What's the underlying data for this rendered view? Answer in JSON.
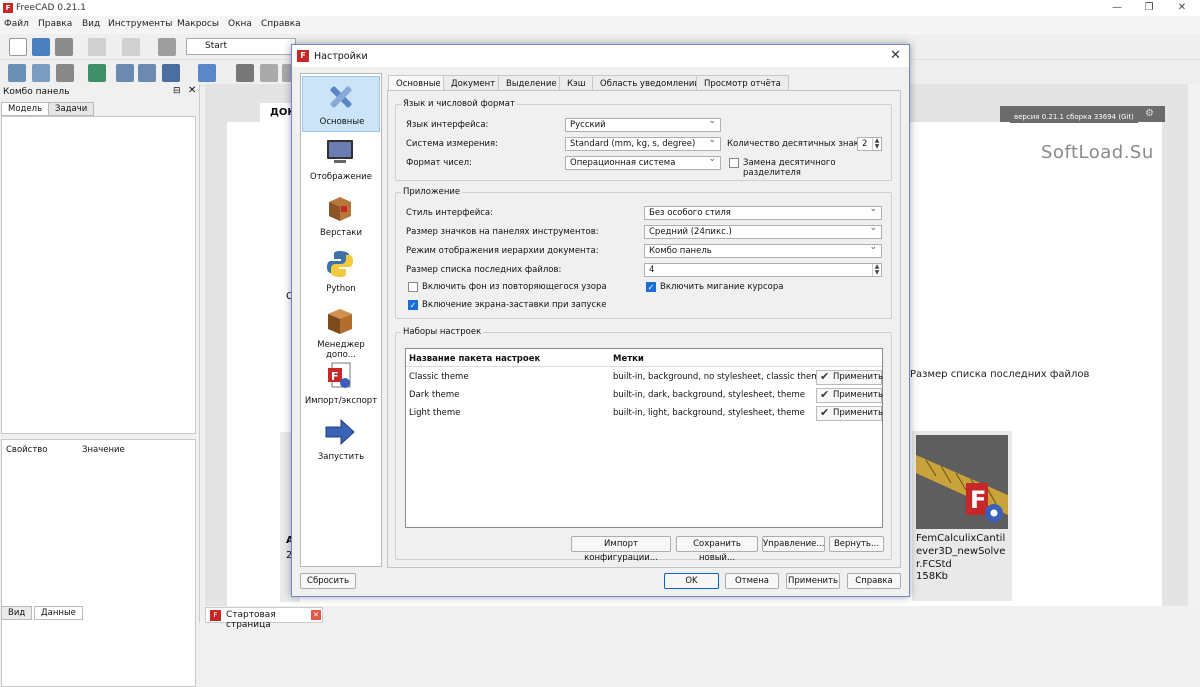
{
  "app": {
    "title": "FreeCAD 0.21.1",
    "menu": [
      "Файл",
      "Правка",
      "Вид",
      "Инструменты",
      "Макросы",
      "Окна",
      "Справка"
    ],
    "workbench": "Start"
  },
  "combo": {
    "title": "Комбо панель",
    "tabs": [
      "Модель",
      "Задачи"
    ],
    "prop_headers": [
      "Свойство",
      "Значение"
    ],
    "bottom_tabs": [
      "Вид",
      "Данные"
    ]
  },
  "startpage": {
    "tab_label": "ДОК",
    "version": "версия 0.21.1 сборка 33694 (Git)",
    "watermark": "SoftLoad.Su",
    "right_label": "Размер списка последних файлов",
    "card": {
      "name": "FemCalculixCantilever3D_newSolver.FCStd",
      "size": "158Kb"
    },
    "left_card_letter": "A",
    "left_card_digit": "2",
    "left_c": "C",
    "bottom_tab": "Стартовая страница"
  },
  "dialog": {
    "title": "Настройки",
    "categories": [
      "Основные",
      "Отображение",
      "Верстаки",
      "Python",
      "Менеджер допо...",
      "Импорт/экспорт",
      "Запустить"
    ],
    "tabs": [
      "Основные",
      "Документ",
      "Выделение",
      "Кэш",
      "Область уведомлений",
      "Просмотр отчёта"
    ],
    "lang_group": {
      "title": "Язык и числовой формат",
      "lang_label": "Язык интерфейса:",
      "lang_value": "Русский",
      "units_label": "Система измерения:",
      "units_value": "Standard (mm, kg, s, degree)",
      "decimals_label": "Количество десятичных знаков:",
      "decimals_value": "2",
      "numfmt_label": "Формат чисел:",
      "numfmt_value": "Операционная система",
      "separator_label": "Замена десятичного разделителя",
      "separator_checked": false
    },
    "app_group": {
      "title": "Приложение",
      "style_label": "Стиль интерфейса:",
      "style_value": "Без особого стиля",
      "iconsize_label": "Размер значков на панелях инструментов:",
      "iconsize_value": "Средний (24пикс.)",
      "tree_label": "Режим отображения иерархии документа:",
      "tree_value": "Комбо панель",
      "recent_label": "Размер списка последних файлов:",
      "recent_value": "4",
      "bg_label": "Включить фон из повторяющегося узора",
      "bg_checked": false,
      "cursor_label": "Включить мигание курсора",
      "cursor_checked": true,
      "splash_label": "Включение экрана-заставки при запуске",
      "splash_checked": true
    },
    "presets_group": {
      "title": "Наборы настроек",
      "headers": [
        "Название пакета настроек",
        "Метки"
      ],
      "rows": [
        {
          "name": "Classic theme",
          "tags": "built-in, background, no stylesheet, classic theme",
          "apply": "Применить"
        },
        {
          "name": "Dark theme",
          "tags": "built-in, dark, background, stylesheet, theme",
          "apply": "Применить"
        },
        {
          "name": "Light theme",
          "tags": "built-in, light, background, stylesheet, theme",
          "apply": "Применить"
        }
      ],
      "buttons": [
        "Импорт конфигурации...",
        "Сохранить новый...",
        "Управление...",
        "Вернуть..."
      ]
    },
    "footer": {
      "reset": "Сбросить",
      "ok": "OK",
      "cancel": "Отмена",
      "apply": "Применить",
      "help": "Справка"
    }
  },
  "colors": {
    "accent": "#1a6fd6",
    "selection": "#cce4f7",
    "brand": "#c62828"
  }
}
